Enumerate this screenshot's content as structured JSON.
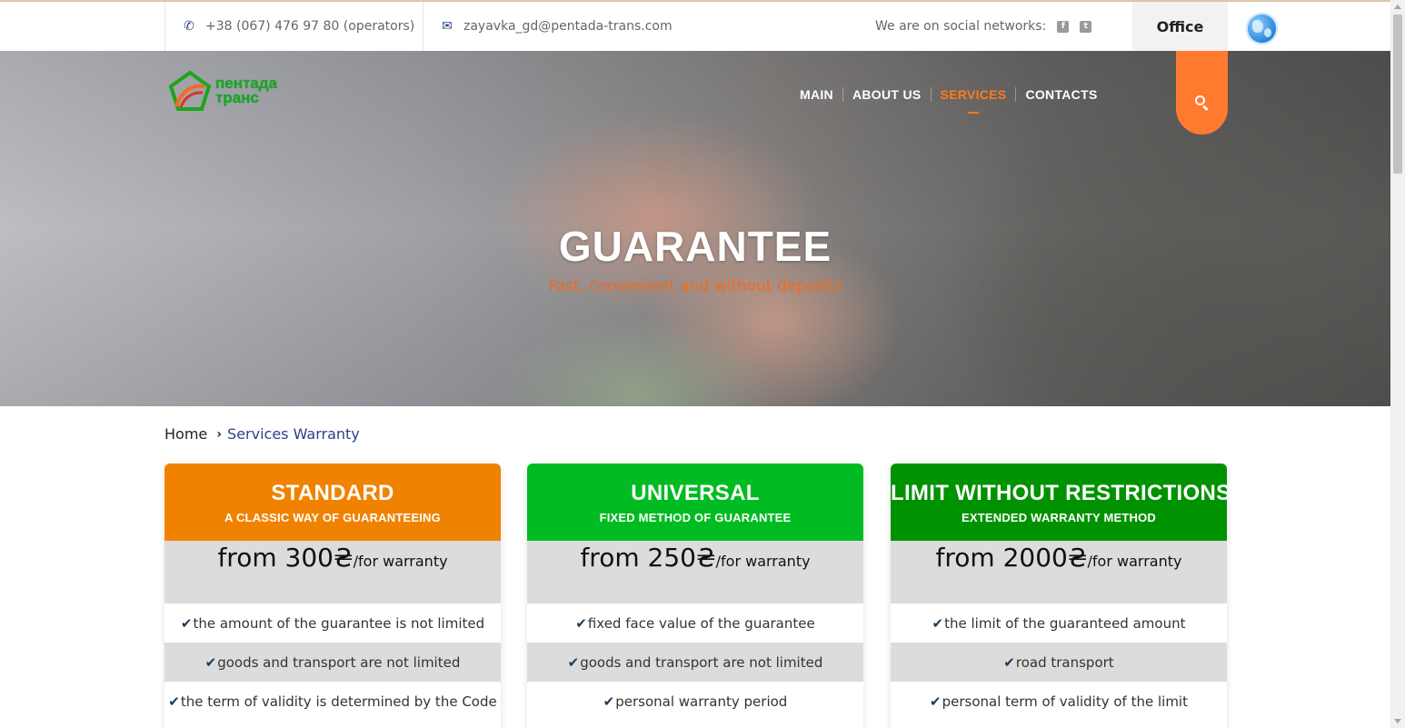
{
  "topbar": {
    "phone": "+38 (067) 476 97 80 (operators)",
    "email": "zayavka_gd@pentada-trans.com",
    "social_label": "We are on social networks:",
    "social": [
      "f",
      "t"
    ],
    "office_label": "Office"
  },
  "logo": {
    "line1": "пентада",
    "line2": "транс"
  },
  "nav": {
    "items": [
      "MAIN",
      "ABOUT US",
      "SERVICES",
      "CONTACTS"
    ],
    "active": "SERVICES"
  },
  "hero": {
    "title": "GUARANTEE",
    "subtitle": "Fast, convenient and without deposits"
  },
  "breadcrumb": {
    "home": "Home",
    "current": "Services Warranty"
  },
  "colors": {
    "accent": "#ff7a2e",
    "standard": "#f08200",
    "universal": "#00bb22",
    "limit": "#009200",
    "nav_blue": "#2d3e8c"
  },
  "cards": [
    {
      "title": "STANDARD",
      "subtitle": "A CLASSIC WAY OF GUARANTEEING",
      "price_prefix": "from 300₴",
      "price_suffix": "/for warranty",
      "features": [
        "the amount of the guarantee is not limited",
        "goods and transport are not limited",
        "the term of validity is determined by the Code"
      ]
    },
    {
      "title": "UNIVERSAL",
      "subtitle": "FIXED METHOD OF GUARANTEE",
      "price_prefix": "from 250₴",
      "price_suffix": "/for warranty",
      "features": [
        "fixed face value of the guarantee",
        "goods and transport are not limited",
        "personal warranty period"
      ]
    },
    {
      "title": "LIMIT WITHOUT RESTRICTIONS",
      "subtitle": "EXTENDED WARRANTY METHOD",
      "price_prefix": "from 2000₴",
      "price_suffix": "/for warranty",
      "features": [
        "the limit of the guaranteed amount",
        "road transport",
        "personal term of validity of the limit"
      ]
    }
  ]
}
